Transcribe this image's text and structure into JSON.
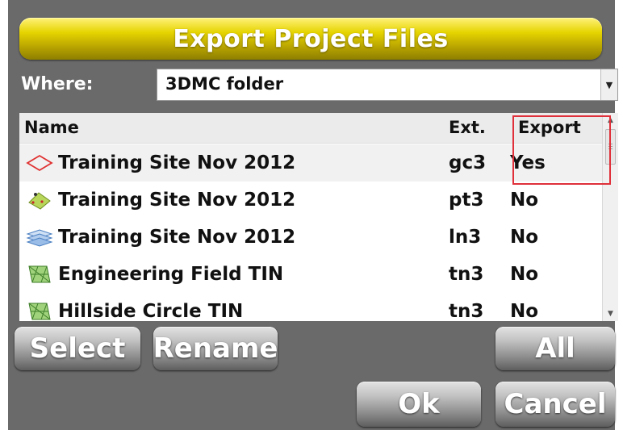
{
  "title": "Export Project Files",
  "where": {
    "label": "Where:",
    "value": "3DMC folder"
  },
  "columns": {
    "name": "Name",
    "ext": "Ext.",
    "export": "Export"
  },
  "files": [
    {
      "name": "Training Site Nov 2012",
      "ext": "gc3",
      "export": "Yes",
      "icon": "site-outline-icon",
      "selected": true
    },
    {
      "name": "Training Site Nov 2012",
      "ext": "pt3",
      "export": "No",
      "icon": "points-icon"
    },
    {
      "name": "Training Site Nov 2012",
      "ext": "ln3",
      "export": "No",
      "icon": "layers-icon"
    },
    {
      "name": "Engineering Field TIN",
      "ext": "tn3",
      "export": "No",
      "icon": "tin-surface-icon"
    },
    {
      "name": "Hillside Circle TIN",
      "ext": "tn3",
      "export": "No",
      "icon": "tin-surface-icon"
    }
  ],
  "buttons": {
    "select": "Select",
    "rename": "Rename",
    "all": "All",
    "ok": "Ok",
    "cancel": "Cancel"
  },
  "colors": {
    "title_bar": "#e6d400",
    "background": "#6a6a6a",
    "highlight": "#e0303a"
  }
}
